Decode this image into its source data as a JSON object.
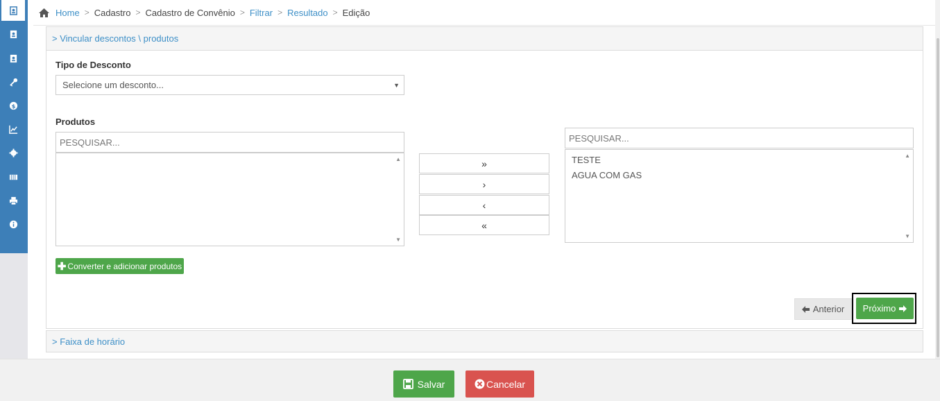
{
  "breadcrumb": {
    "home": "Home",
    "cadastro": "Cadastro",
    "cadastro_convenio": "Cadastro de Convênio",
    "filtrar": "Filtrar",
    "resultado": "Resultado",
    "edicao": "Edição",
    "separator": ">"
  },
  "sidebar": {
    "icons": [
      "contact-book-icon",
      "address-book-icon",
      "address-card-icon",
      "key-icon",
      "dollar-icon",
      "chart-icon",
      "gear-icon",
      "barcode-icon",
      "printer-icon",
      "info-icon"
    ]
  },
  "panel": {
    "title": "> Vincular descontos \\ produtos",
    "tipo_desconto_label": "Tipo de Desconto",
    "tipo_desconto_value": "Selecione um desconto...",
    "produtos_label": "Produtos",
    "left_search_placeholder": "PESQUISAR...",
    "right_search_placeholder": "PESQUISAR...",
    "left_items": [],
    "right_items": [
      "TESTE",
      "AGUA COM GAS"
    ],
    "move_all_right": "»",
    "move_right": "›",
    "move_left": "‹",
    "move_all_left": "«",
    "convert_button": "Converter e adicionar produtos",
    "prev_button": "Anterior",
    "next_button": "Próximo"
  },
  "accordion2": {
    "title": "> Faixa de horário"
  },
  "footer": {
    "save": "Salvar",
    "cancel": "Cancelar"
  },
  "colors": {
    "sidebar": "#3d7fb8",
    "link": "#3d8fc7",
    "green": "#4ea64a",
    "red": "#d9534f"
  }
}
